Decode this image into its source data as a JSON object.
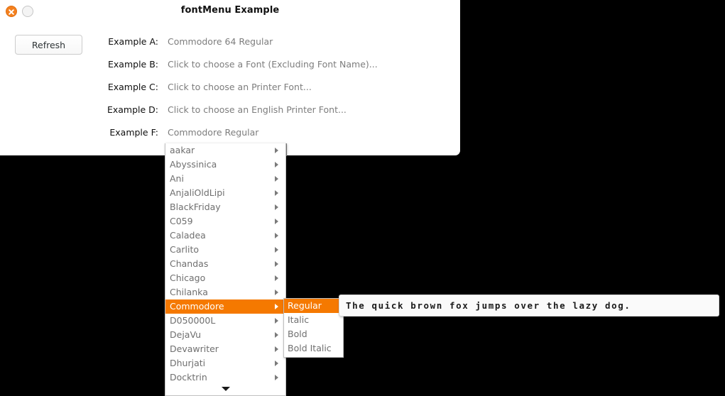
{
  "window": {
    "title": "fontMenu Example",
    "close_icon": "close-x-icon",
    "minmax_icon": "maximize-circle-icon"
  },
  "toolbar": {
    "refresh_label": "Refresh"
  },
  "examples": [
    {
      "label": "Example A:",
      "value": "Commodore 64 Regular"
    },
    {
      "label": "Example B:",
      "value": "Click to choose a Font (Excluding Font Name)..."
    },
    {
      "label": "Example C:",
      "value": "Click to choose an Printer Font..."
    },
    {
      "label": "Example D:",
      "value": "Click to choose an English Printer Font..."
    },
    {
      "label": "Example F:",
      "value": "Commodore Regular"
    }
  ],
  "font_menu": {
    "selected": "Commodore",
    "scroll_down_icon": "chevron-down-icon",
    "items": [
      {
        "label": "aakar",
        "has_submenu": true
      },
      {
        "label": "Abyssinica",
        "has_submenu": true
      },
      {
        "label": "Ani",
        "has_submenu": true
      },
      {
        "label": "AnjaliOldLipi",
        "has_submenu": true
      },
      {
        "label": "BlackFriday",
        "has_submenu": true
      },
      {
        "label": "C059",
        "has_submenu": true
      },
      {
        "label": "Caladea",
        "has_submenu": true
      },
      {
        "label": "Carlito",
        "has_submenu": true
      },
      {
        "label": "Chandas",
        "has_submenu": true
      },
      {
        "label": "Chicago",
        "has_submenu": true
      },
      {
        "label": "Chilanka",
        "has_submenu": true
      },
      {
        "label": "Commodore",
        "has_submenu": true
      },
      {
        "label": "D050000L",
        "has_submenu": true
      },
      {
        "label": "DejaVu",
        "has_submenu": true
      },
      {
        "label": "Devawriter",
        "has_submenu": true
      },
      {
        "label": "Dhurjati",
        "has_submenu": true
      },
      {
        "label": "Docktrin",
        "has_submenu": true
      }
    ]
  },
  "style_submenu": {
    "selected": "Regular",
    "items": [
      {
        "label": "Regular"
      },
      {
        "label": "Italic"
      },
      {
        "label": "Bold"
      },
      {
        "label": "Bold Italic"
      }
    ]
  },
  "preview": {
    "text": "The quick brown fox jumps over the lazy dog."
  },
  "colors": {
    "highlight": "#f57900",
    "close_button": "#f4801e",
    "menu_text": "#6f6f6f",
    "value_text": "#7d7d7d",
    "desktop": "#000000"
  }
}
